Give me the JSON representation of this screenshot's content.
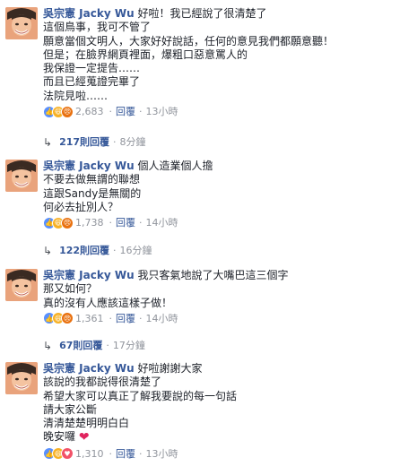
{
  "comments": [
    {
      "author": "吳宗憲 Jacky Wu",
      "lines": [
        "好啦！我已經說了很清楚了",
        "這個鳥事，我可不管了",
        "願意當個文明人，大家好好說話，任何的意見我們都願意聽！",
        "但是；在臉界網頁裡面，爆粗口惡意罵人的",
        "我保證一定提告……",
        "而且已經蒐證完畢了",
        "法院見啦……"
      ],
      "reactions_icons": [
        "like-icon",
        "haha-icon",
        "angry-icon"
      ],
      "reaction_count": "2,683",
      "reply_label": "回覆",
      "time": "13小時",
      "replies": "217則回覆",
      "replies_time": "8分鐘"
    },
    {
      "author": "吳宗憲 Jacky Wu",
      "lines": [
        "個人造業個人擔",
        "不要去做無謂的聯想",
        "這跟Sandy是無關的",
        "何必去扯別人？"
      ],
      "reactions_icons": [
        "like-icon",
        "haha-icon",
        "angry-icon"
      ],
      "reaction_count": "1,738",
      "reply_label": "回覆",
      "time": "14小時",
      "replies": "122則回覆",
      "replies_time": "16分鐘"
    },
    {
      "author": "吳宗憲 Jacky Wu",
      "lines": [
        "我只客氣地說了大嘴巴這三個字",
        "那又如何？",
        "真的沒有人應該這樣子做！"
      ],
      "reactions_icons": [
        "like-icon",
        "haha-icon",
        "angry-icon"
      ],
      "reaction_count": "1,361",
      "reply_label": "回覆",
      "time": "14小時",
      "replies": "67則回覆",
      "replies_time": "17分鐘"
    },
    {
      "author": "吳宗憲 Jacky Wu",
      "lines": [
        "好啦謝謝大家",
        "該說的我都說得很清楚了",
        "希望大家可以真正了解我要說的每一句話",
        "請大家公斷",
        "清清楚楚明明白白",
        "晚安囉"
      ],
      "heart": "❤",
      "reactions_icons": [
        "like-icon",
        "haha-icon",
        "love-icon"
      ],
      "reaction_count": "1,310",
      "reply_label": "回覆",
      "time": "13小時"
    }
  ],
  "colors": {
    "author": "#365899",
    "meta": "#90949c",
    "text": "#1d2129"
  }
}
